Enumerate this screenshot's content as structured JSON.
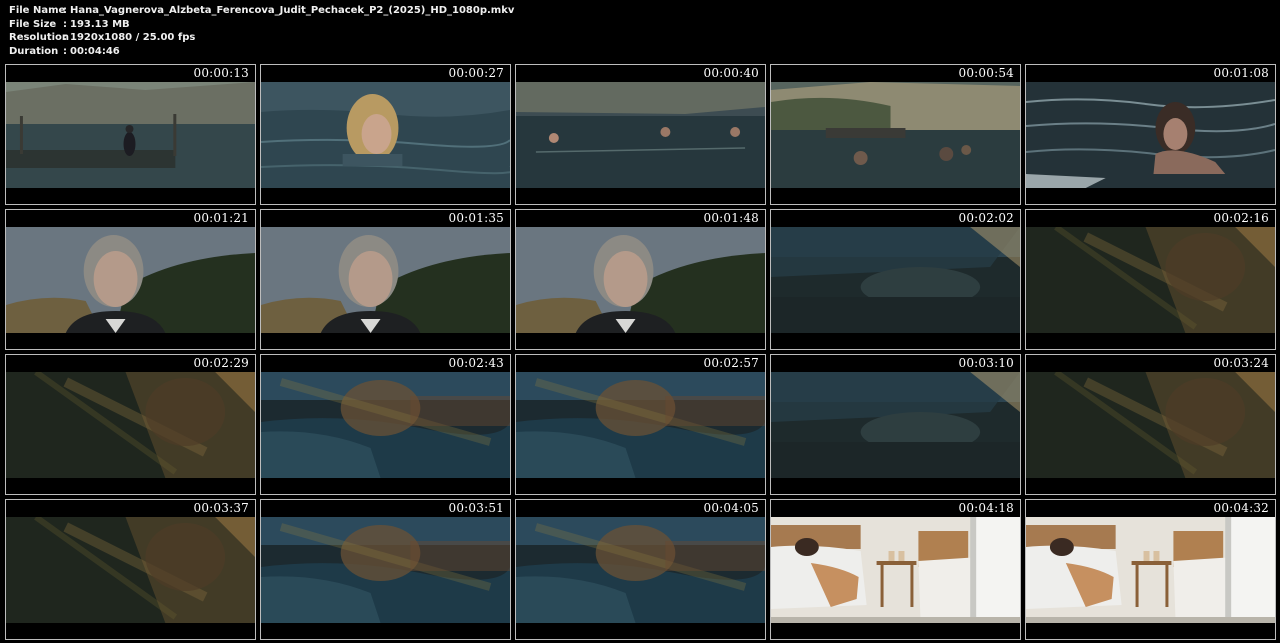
{
  "file_info": [
    {
      "label": "File Name",
      "value": "Hana_Vagnerova_Alzbeta_Ferencova_Judit_Pechacek_P2_(2025)_HD_1080p.mkv"
    },
    {
      "label": "File Size",
      "value": "193.13 MB"
    },
    {
      "label": "Resolution",
      "value": "1920x1080 / 25.00 fps"
    },
    {
      "label": "Duration",
      "value": "00:04:46"
    }
  ],
  "separator": ":",
  "thumbnails": [
    {
      "time": "00:00:13",
      "scene": "lake-dock"
    },
    {
      "time": "00:00:27",
      "scene": "swimmer-blonde"
    },
    {
      "time": "00:00:40",
      "scene": "lake-swimmers"
    },
    {
      "time": "00:00:54",
      "scene": "lake-dock-swimmers"
    },
    {
      "time": "00:01:08",
      "scene": "swimmer-dark"
    },
    {
      "time": "00:01:21",
      "scene": "woman-hillside"
    },
    {
      "time": "00:01:35",
      "scene": "woman-hillside"
    },
    {
      "time": "00:01:48",
      "scene": "woman-hillside"
    },
    {
      "time": "00:02:02",
      "scene": "tent-dark"
    },
    {
      "time": "00:02:16",
      "scene": "tent-warm"
    },
    {
      "time": "00:02:29",
      "scene": "tent-warm"
    },
    {
      "time": "00:02:43",
      "scene": "tent-blue"
    },
    {
      "time": "00:02:57",
      "scene": "tent-blue"
    },
    {
      "time": "00:03:10",
      "scene": "tent-dark"
    },
    {
      "time": "00:03:24",
      "scene": "tent-warm"
    },
    {
      "time": "00:03:37",
      "scene": "tent-warm"
    },
    {
      "time": "00:03:51",
      "scene": "tent-blue"
    },
    {
      "time": "00:04:05",
      "scene": "tent-blue"
    },
    {
      "time": "00:04:18",
      "scene": "bedroom"
    },
    {
      "time": "00:04:32",
      "scene": "bedroom"
    }
  ]
}
